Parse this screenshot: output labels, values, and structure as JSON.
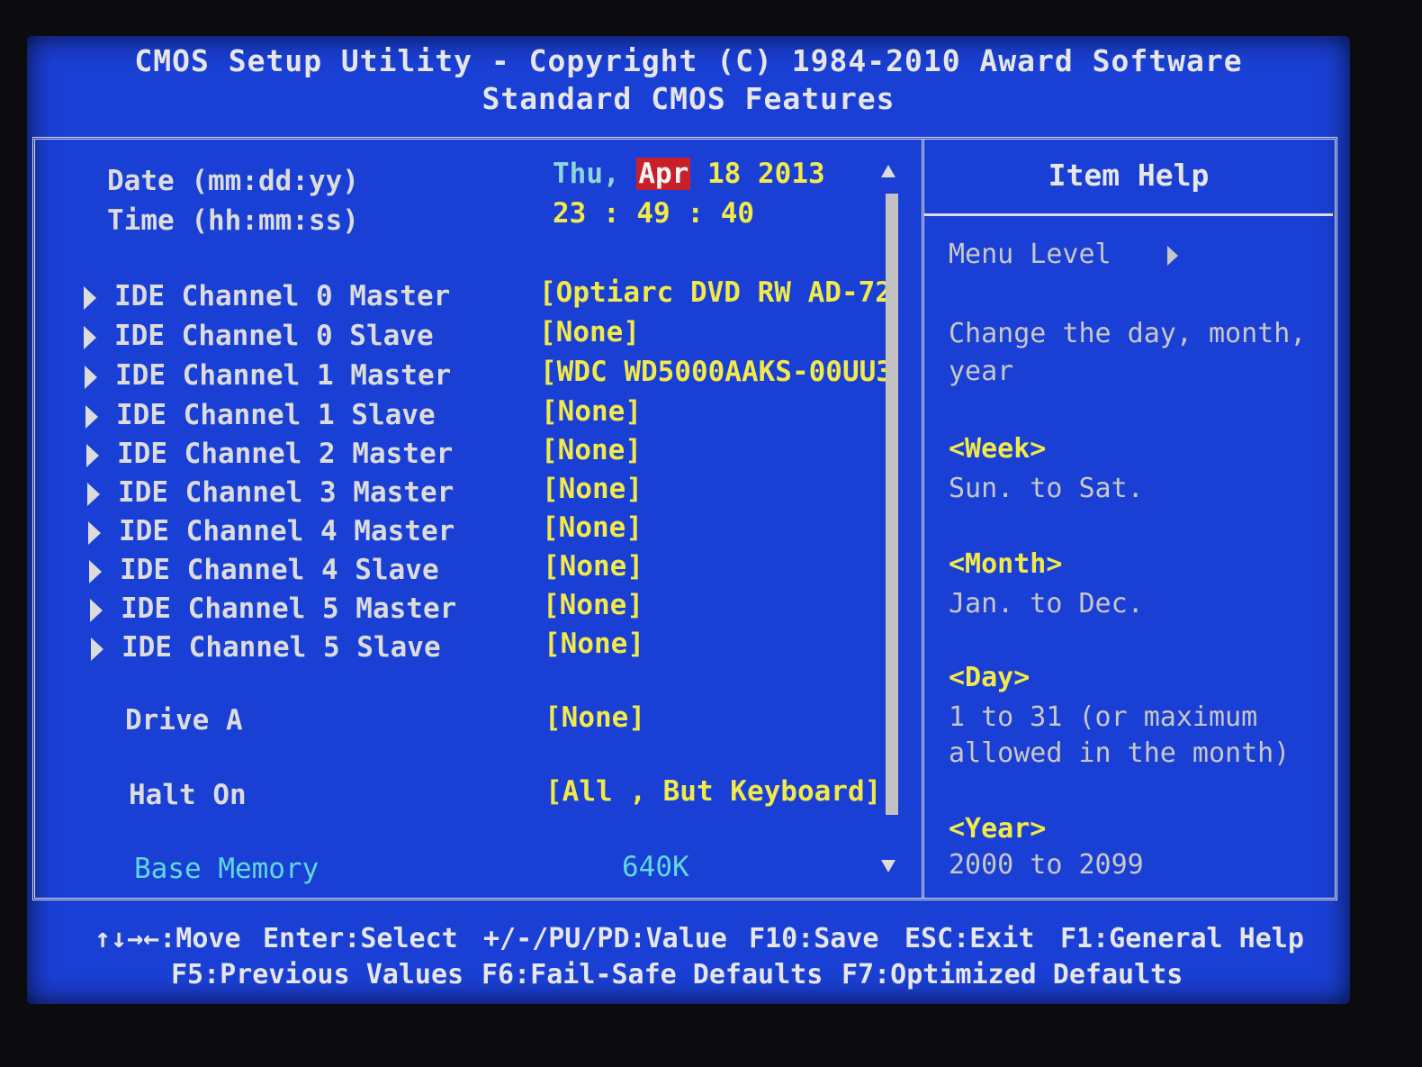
{
  "header": {
    "title": "CMOS Setup Utility - Copyright (C) 1984-2010 Award Software",
    "subtitle": "Standard CMOS Features"
  },
  "date": {
    "label": "Date (mm:dd:yy)",
    "weekday": "Thu,",
    "month": "Apr",
    "day": "18",
    "year": "2013"
  },
  "time": {
    "label": "Time (hh:mm:ss)",
    "hour": "23",
    "sep1": ":",
    "minute": "49",
    "sep2": ":",
    "second": "40"
  },
  "ide_channels": [
    {
      "label": "IDE Channel 0 Master",
      "value": "[Optiarc DVD RW AD-72"
    },
    {
      "label": "IDE Channel 0 Slave",
      "value": "[None]"
    },
    {
      "label": "IDE Channel 1 Master",
      "value": "[WDC WD5000AAKS-00UU3"
    },
    {
      "label": "IDE Channel 1 Slave",
      "value": "[None]"
    },
    {
      "label": "IDE Channel 2 Master",
      "value": "[None]"
    },
    {
      "label": "IDE Channel 3 Master",
      "value": "[None]"
    },
    {
      "label": "IDE Channel 4 Master",
      "value": "[None]"
    },
    {
      "label": "IDE Channel 4 Slave",
      "value": "[None]"
    },
    {
      "label": "IDE Channel 5 Master",
      "value": "[None]"
    },
    {
      "label": "IDE Channel 5 Slave",
      "value": "[None]"
    }
  ],
  "drive_a": {
    "label": "Drive A",
    "value": "[None]"
  },
  "halt_on": {
    "label": "Halt On",
    "value": "[All , But Keyboard]"
  },
  "base_memory": {
    "label": "Base Memory",
    "value": "640K"
  },
  "help": {
    "title": "Item Help",
    "menu_level": "Menu Level",
    "line1": "Change the day, month,",
    "line2": "year",
    "week_h": "<Week>",
    "week_d": "Sun. to Sat.",
    "month_h": "<Month>",
    "month_d": "Jan. to Dec.",
    "day_h": "<Day>",
    "day_d1": "1 to 31 (or maximum",
    "day_d2": "allowed in the month)",
    "year_h": "<Year>",
    "year_d": "2000 to 2099"
  },
  "footer": {
    "move": "↑↓→←:Move",
    "enter": "Enter:Select",
    "value": "+/-/PU/PD:Value",
    "save": "F10:Save",
    "exit": "ESC:Exit",
    "help": "F1:General Help",
    "prev": "F5:Previous Values",
    "failsafe": "F6:Fail-Safe Defaults",
    "optimized": "F7:Optimized Defaults"
  },
  "colors": {
    "background": "#1a3fd4",
    "value_text": "#f2e94a",
    "selection": "#c8202a",
    "info_text": "#5fd8e0"
  }
}
